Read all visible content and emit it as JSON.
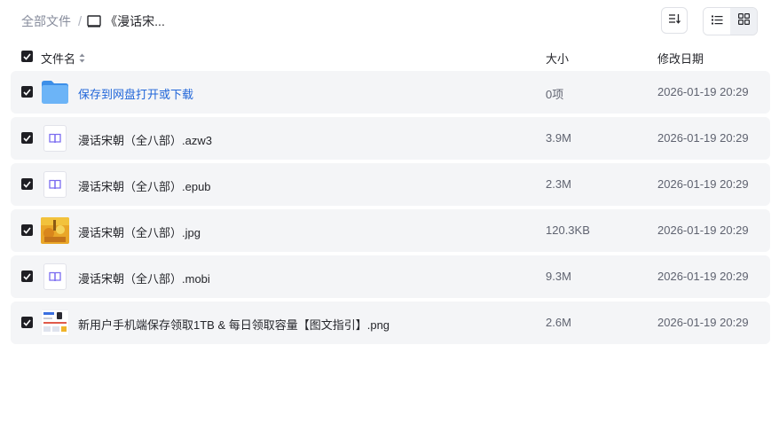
{
  "breadcrumb": {
    "root": "全部文件",
    "separator": "/",
    "current": "《漫话宋..."
  },
  "toolbar": {
    "sort_icon": "sort-icon",
    "list_view_icon": "list-view-icon",
    "grid_view_icon": "grid-view-icon"
  },
  "columns": {
    "name": "文件名",
    "size": "大小",
    "modified": "修改日期"
  },
  "files": [
    {
      "name": "保存到网盘打开或下载",
      "size": "0项",
      "date": "2026-01-19 20:29",
      "type": "folder",
      "checked": true
    },
    {
      "name": "漫话宋朝（全八部）.azw3",
      "size": "3.9M",
      "date": "2026-01-19 20:29",
      "type": "ebook",
      "checked": true
    },
    {
      "name": "漫话宋朝（全八部）.epub",
      "size": "2.3M",
      "date": "2026-01-19 20:29",
      "type": "ebook",
      "checked": true
    },
    {
      "name": "漫话宋朝（全八部）.jpg",
      "size": "120.3KB",
      "date": "2026-01-19 20:29",
      "type": "image",
      "checked": true
    },
    {
      "name": "漫话宋朝（全八部）.mobi",
      "size": "9.3M",
      "date": "2026-01-19 20:29",
      "type": "ebook",
      "checked": true
    },
    {
      "name": "新用户手机端保存领取1TB & 每日领取容量【图文指引】.png",
      "size": "2.6M",
      "date": "2026-01-19 20:29",
      "type": "image",
      "checked": true
    }
  ],
  "colors": {
    "link": "#2166d9",
    "row_bg": "#f4f5f7",
    "checkbox": "#1f1f24",
    "ebook_icon": "#7b6cf0",
    "folder": "#5aa7f5"
  }
}
